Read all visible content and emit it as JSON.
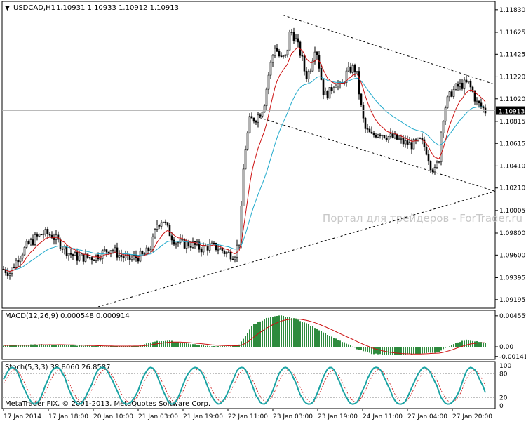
{
  "chart_data": {
    "type": "candlestick",
    "header": {
      "symbol_label": "USDCAD,H1",
      "ohlc_values": "1.10931 1.10933 1.10912 1.10913"
    },
    "price_axis": {
      "ticks": [
        "1.11830",
        "1.11625",
        "1.11425",
        "1.11220",
        "1.11020",
        "1.10815",
        "1.10615",
        "1.10410",
        "1.10210",
        "1.10005",
        "1.09800",
        "1.09600",
        "1.09395",
        "1.09195"
      ],
      "range": [
        1.0913,
        1.1188
      ],
      "current_price": "1.10913"
    },
    "time_axis": {
      "labels": [
        "17 Jan 2014",
        "17 Jan 18:00",
        "20 Jan 10:00",
        "21 Jan 03:00",
        "21 Jan 19:00",
        "22 Jan 11:00",
        "23 Jan 03:00",
        "23 Jan 19:00",
        "24 Jan 11:00",
        "27 Jan 04:00",
        "27 Jan 20:00"
      ]
    },
    "watermark": "Портал для трейдеров - ForTrader.ru",
    "copyright": "MetaTrader FIX, © 2001-2013, MetaQuotes Software Corp.",
    "price_path": [
      [
        0,
        1.0949
      ],
      [
        14,
        1.0944
      ],
      [
        26,
        1.0958
      ],
      [
        38,
        1.0968
      ],
      [
        50,
        1.0975
      ],
      [
        62,
        1.098
      ],
      [
        74,
        1.0978
      ],
      [
        86,
        1.097
      ],
      [
        98,
        1.0962
      ],
      [
        110,
        1.0958
      ],
      [
        122,
        1.0958
      ],
      [
        134,
        1.0958
      ],
      [
        146,
        1.0962
      ],
      [
        158,
        1.0966
      ],
      [
        170,
        1.096
      ],
      [
        182,
        1.0956
      ],
      [
        194,
        1.0958
      ],
      [
        206,
        1.096
      ],
      [
        216,
        1.0968
      ],
      [
        224,
        1.0988
      ],
      [
        232,
        1.0993
      ],
      [
        240,
        1.0982
      ],
      [
        250,
        1.0972
      ],
      [
        262,
        1.097
      ],
      [
        274,
        1.097
      ],
      [
        286,
        1.0966
      ],
      [
        298,
        1.0968
      ],
      [
        310,
        1.0967
      ],
      [
        322,
        1.0962
      ],
      [
        334,
        1.096
      ],
      [
        342,
        1.0975
      ],
      [
        348,
        1.105
      ],
      [
        356,
        1.1082
      ],
      [
        366,
        1.1085
      ],
      [
        376,
        1.1095
      ],
      [
        384,
        1.1128
      ],
      [
        392,
        1.115
      ],
      [
        400,
        1.1138
      ],
      [
        408,
        1.114
      ],
      [
        414,
        1.1165
      ],
      [
        422,
        1.1155
      ],
      [
        430,
        1.114
      ],
      [
        436,
        1.1122
      ],
      [
        442,
        1.1128
      ],
      [
        450,
        1.1152
      ],
      [
        456,
        1.1128
      ],
      [
        462,
        1.1105
      ],
      [
        470,
        1.1108
      ],
      [
        478,
        1.1118
      ],
      [
        486,
        1.1112
      ],
      [
        494,
        1.1125
      ],
      [
        502,
        1.113
      ],
      [
        508,
        1.1128
      ],
      [
        514,
        1.1098
      ],
      [
        520,
        1.1075
      ],
      [
        530,
        1.1068
      ],
      [
        540,
        1.1072
      ],
      [
        552,
        1.1068
      ],
      [
        564,
        1.1066
      ],
      [
        576,
        1.1062
      ],
      [
        588,
        1.106
      ],
      [
        600,
        1.1064
      ],
      [
        608,
        1.1055
      ],
      [
        614,
        1.1042
      ],
      [
        620,
        1.1036
      ],
      [
        626,
        1.1048
      ],
      [
        630,
        1.108
      ],
      [
        636,
        1.1098
      ],
      [
        644,
        1.1108
      ],
      [
        652,
        1.1113
      ],
      [
        660,
        1.1115
      ],
      [
        668,
        1.1116
      ],
      [
        674,
        1.1108
      ],
      [
        680,
        1.1098
      ],
      [
        686,
        1.1095
      ],
      [
        692,
        1.1091
      ]
    ],
    "indicators": {
      "ma_fast_color": "#cc1111",
      "ma_slow_color": "#22aacc",
      "bull_color": "#000000",
      "bear_color": "#000000"
    },
    "trendlines": [
      {
        "kind": "resistance",
        "from": [
          404,
          1.1178
        ],
        "to": [
          706,
          1.1115
        ]
      },
      {
        "kind": "support-channel",
        "from": [
          370,
          1.1085
        ],
        "to": [
          706,
          1.1018
        ]
      },
      {
        "kind": "long-support",
        "from": [
          140,
          1.0913
        ],
        "to": [
          706,
          1.1018
        ]
      }
    ],
    "macd": {
      "label": "MACD(12,26,9) 0.000548 0.000914",
      "ticks": [
        "0.004559",
        "0.00",
        "-0.001419"
      ],
      "range": [
        -0.00165,
        0.00475
      ],
      "histogram": [
        [
          0,
          0.0002
        ],
        [
          30,
          0.00025
        ],
        [
          60,
          0.00035
        ],
        [
          90,
          0.0003
        ],
        [
          120,
          0.00015
        ],
        [
          150,
          0.0001
        ],
        [
          180,
          8e-05
        ],
        [
          200,
          0.00015
        ],
        [
          220,
          0.0008
        ],
        [
          240,
          0.0009
        ],
        [
          260,
          0.0006
        ],
        [
          280,
          0.0003
        ],
        [
          300,
          0.0001
        ],
        [
          320,
          5e-05
        ],
        [
          340,
          0.0002
        ],
        [
          350,
          0.0016
        ],
        [
          360,
          0.0032
        ],
        [
          380,
          0.0042
        ],
        [
          400,
          0.0046
        ],
        [
          420,
          0.0042
        ],
        [
          440,
          0.0033
        ],
        [
          460,
          0.0022
        ],
        [
          480,
          0.0011
        ],
        [
          500,
          0.0002
        ],
        [
          510,
          -0.0004
        ],
        [
          530,
          -0.001
        ],
        [
          550,
          -0.00115
        ],
        [
          570,
          -0.0012
        ],
        [
          590,
          -0.0011
        ],
        [
          610,
          -0.0009
        ],
        [
          625,
          -0.0008
        ],
        [
          635,
          -0.0002
        ],
        [
          650,
          0.0006
        ],
        [
          665,
          0.001
        ],
        [
          680,
          0.0008
        ],
        [
          692,
          0.00055
        ]
      ]
    },
    "stoch": {
      "label": "Stoch(5,3,3) 38.8060 26.8587",
      "ticks": [
        "100",
        "80",
        "20",
        "0"
      ],
      "range": [
        0,
        100
      ]
    }
  }
}
